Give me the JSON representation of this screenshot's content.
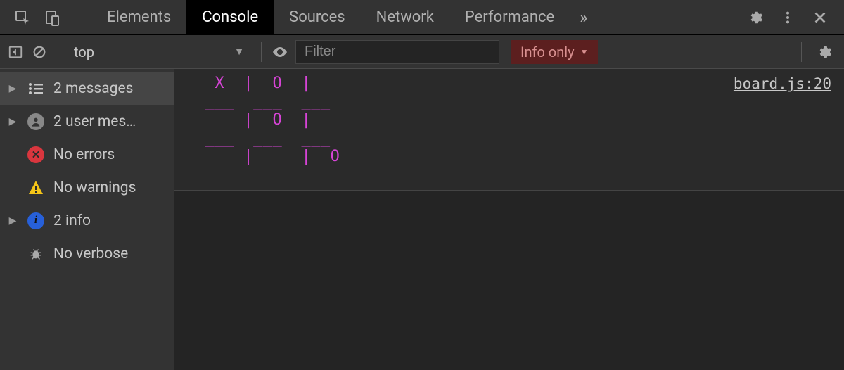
{
  "tabs": {
    "items": [
      "Elements",
      "Console",
      "Sources",
      "Network",
      "Performance"
    ],
    "active_index": 1,
    "overflow_glyph": "»"
  },
  "toolbar": {
    "context_label": "top",
    "filter_placeholder": "Filter",
    "level_filter_label": "Info only"
  },
  "sidebar": {
    "rows": [
      {
        "kind": "messages",
        "label": "2 messages",
        "expandable": true,
        "active": true
      },
      {
        "kind": "user",
        "label": "2 user mes…",
        "expandable": true,
        "active": false
      },
      {
        "kind": "errors",
        "label": "No errors",
        "expandable": false,
        "active": false
      },
      {
        "kind": "warnings",
        "label": "No warnings",
        "expandable": false,
        "active": false
      },
      {
        "kind": "info",
        "label": "2 info",
        "expandable": true,
        "active": false
      },
      {
        "kind": "verbose",
        "label": "No verbose",
        "expandable": false,
        "active": false
      }
    ]
  },
  "message": {
    "lines": [
      "  X  |  O  |    ",
      " ___  ___  ___ ",
      "     |  O  |    ",
      " ___  ___  ___ ",
      "     |     |  O ",
      "               "
    ],
    "source": "board.js:20"
  }
}
